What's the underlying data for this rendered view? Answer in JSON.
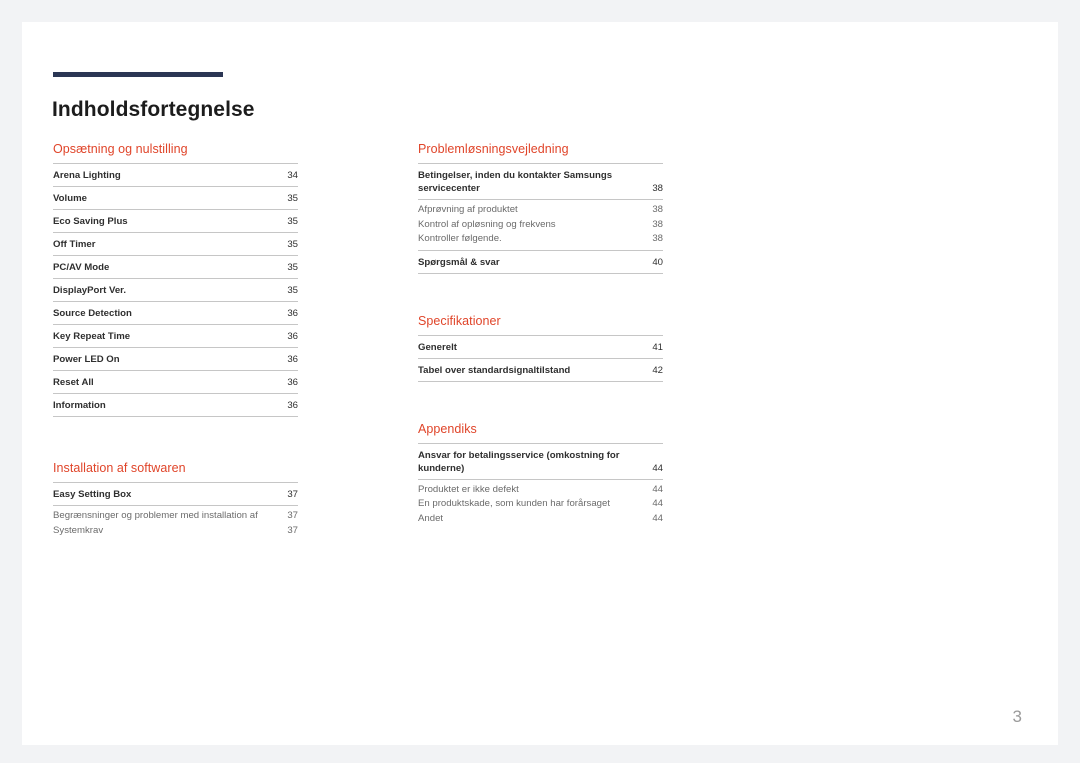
{
  "document": {
    "title": "Indholdsfortegnelse",
    "folio": "3",
    "accent_color": "#e0452a",
    "rule_color": "#2b3654",
    "divider_color": "#c6c6c6",
    "page_background": "#ffffff",
    "canvas_background": "#f2f3f5"
  },
  "left_column": [
    {
      "heading": "Opsætning og nulstilling",
      "entries": [
        {
          "type": "main",
          "label": "Arena Lighting",
          "page": "34"
        },
        {
          "type": "main",
          "label": "Volume",
          "page": "35"
        },
        {
          "type": "main",
          "label": "Eco Saving Plus",
          "page": "35"
        },
        {
          "type": "main",
          "label": "Off Timer",
          "page": "35"
        },
        {
          "type": "main",
          "label": "PC/AV Mode",
          "page": "35"
        },
        {
          "type": "main",
          "label": "DisplayPort Ver.",
          "page": "35"
        },
        {
          "type": "main",
          "label": "Source Detection",
          "page": "36"
        },
        {
          "type": "main",
          "label": "Key Repeat Time",
          "page": "36"
        },
        {
          "type": "main",
          "label": "Power LED On",
          "page": "36"
        },
        {
          "type": "main",
          "label": "Reset All",
          "page": "36"
        },
        {
          "type": "main",
          "label": "Information",
          "page": "36"
        }
      ]
    },
    {
      "heading": "Installation af softwaren",
      "entries": [
        {
          "type": "main",
          "label": "Easy Setting Box",
          "page": "37"
        },
        {
          "type": "sub",
          "label": "Begrænsninger og problemer med installation af",
          "page": "37"
        },
        {
          "type": "sub",
          "label": "Systemkrav",
          "page": "37"
        }
      ]
    }
  ],
  "right_column": [
    {
      "heading": "Problemløsningsvejledning",
      "entries": [
        {
          "type": "main-wrap",
          "label": "Betingelser, inden du kontakter Samsungs servicecenter",
          "page": "38"
        },
        {
          "type": "sub",
          "label": "Afprøvning af produktet",
          "page": "38"
        },
        {
          "type": "sub",
          "label": "Kontrol af opløsning og frekvens",
          "page": "38"
        },
        {
          "type": "sub",
          "label": "Kontroller følgende.",
          "page": "38"
        },
        {
          "type": "main",
          "label": "Spørgsmål & svar",
          "page": "40"
        }
      ]
    },
    {
      "heading": "Specifikationer",
      "entries": [
        {
          "type": "main",
          "label": "Generelt",
          "page": "41"
        },
        {
          "type": "main",
          "label": "Tabel over standardsignaltilstand",
          "page": "42"
        }
      ]
    },
    {
      "heading": "Appendiks",
      "entries": [
        {
          "type": "main-wrap",
          "label": "Ansvar for betalingsservice (omkostning for kunderne)",
          "page": "44"
        },
        {
          "type": "sub",
          "label": "Produktet er ikke defekt",
          "page": "44"
        },
        {
          "type": "sub",
          "label": "En produktskade, som kunden har forårsaget",
          "page": "44"
        },
        {
          "type": "sub",
          "label": "Andet",
          "page": "44"
        }
      ]
    }
  ]
}
